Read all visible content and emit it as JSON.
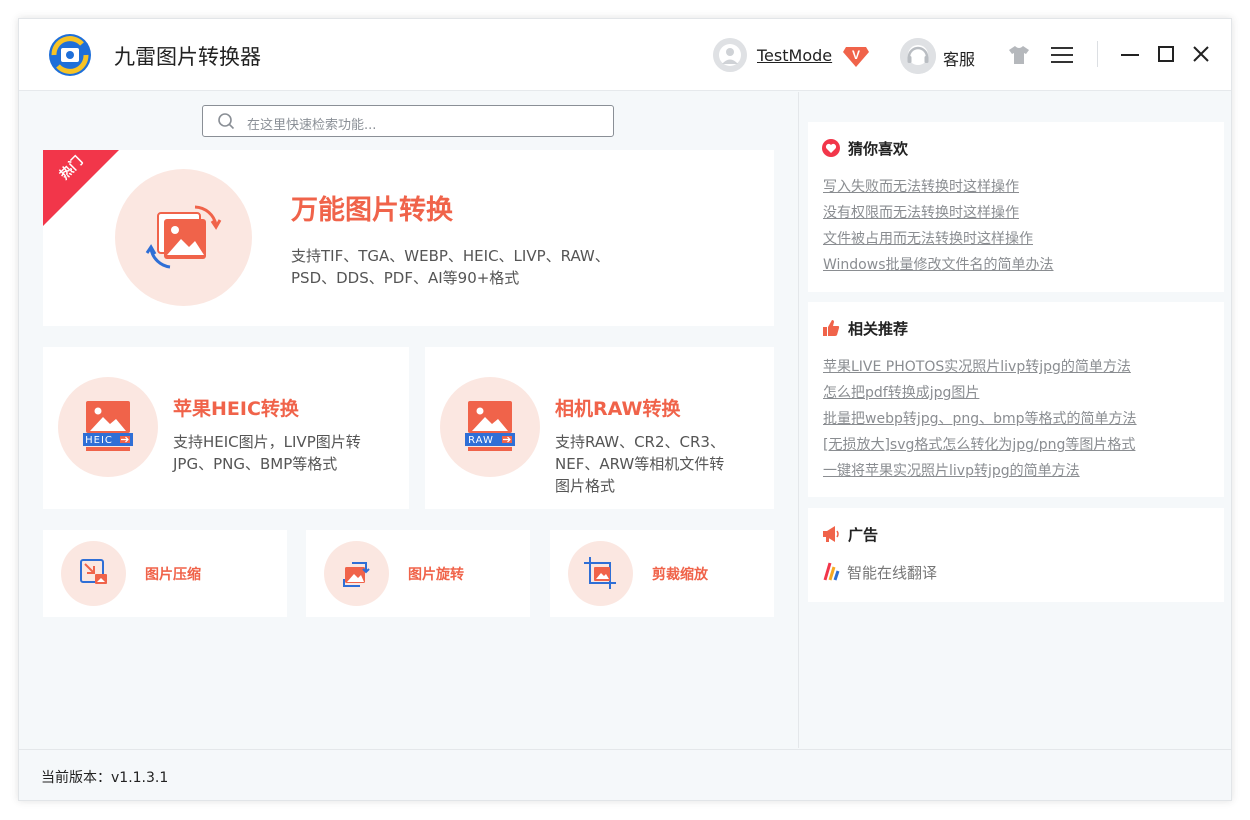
{
  "app": {
    "title": "九雷图片转换器"
  },
  "header": {
    "user_name": "TestMode",
    "vip_label": "V",
    "service_label": "客服"
  },
  "search": {
    "placeholder": "在这里快速检索功能..."
  },
  "hot": {
    "badge": "热门",
    "title": "万能图片转换",
    "desc_line1": "支持TIF、TGA、WEBP、HEIC、LIVP、RAW、",
    "desc_line2": "PSD、DDS、PDF、AI等90+格式"
  },
  "features": [
    {
      "title": "苹果HEIC转换",
      "badge": "HEIC",
      "desc_line1": "支持HEIC图片，LIVP图片转",
      "desc_line2": "JPG、PNG、BMP等格式",
      "desc_line3": ""
    },
    {
      "title": "相机RAW转换",
      "badge": "RAW",
      "desc_line1": "支持RAW、CR2、CR3、",
      "desc_line2": "NEF、ARW等相机文件转",
      "desc_line3": "图片格式"
    }
  ],
  "tools": [
    {
      "label": "图片压缩",
      "icon": "compress-icon"
    },
    {
      "label": "图片旋转",
      "icon": "rotate-icon"
    },
    {
      "label": "剪裁缩放",
      "icon": "crop-icon"
    }
  ],
  "sidebar": {
    "like": {
      "title": "猜你喜欢",
      "links": [
        "写入失败而无法转换时这样操作",
        "没有权限而无法转换时这样操作",
        "文件被占用而无法转换时这样操作",
        "Windows批量修改文件名的简单办法"
      ]
    },
    "recommend": {
      "title": "相关推荐",
      "links": [
        "苹果LIVE PHOTOS实况照片livp转jpg的简单方法",
        "怎么把pdf转换成jpg图片",
        "批量把webp转jpg、png、bmp等格式的简单方法",
        "[无损放大]svg格式怎么转化为jpg/png等图片格式",
        "一键将苹果实况照片livp转jpg的简单方法"
      ]
    },
    "ad": {
      "title": "广告",
      "item": "智能在线翻译"
    }
  },
  "status": {
    "version": "当前版本：v1.1.3.1"
  },
  "colors": {
    "accent": "#f0634a",
    "circle_bg": "#fbe7e1",
    "icon_blue": "#2f6fd6"
  }
}
